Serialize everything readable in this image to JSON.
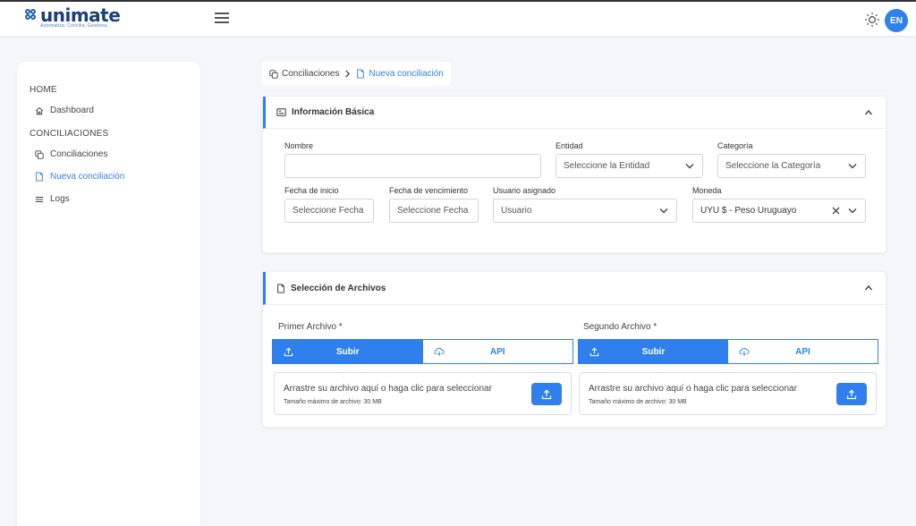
{
  "header": {
    "logo_name": "unimate",
    "logo_tagline": "Automatiza. Concilia. Gestiona.",
    "lang": "EN",
    "icons": {
      "menu": "hamburger-icon",
      "theme": "sun-icon"
    }
  },
  "sidebar": {
    "sections": [
      {
        "title": "HOME",
        "items": [
          {
            "label": "Dashboard",
            "icon": "home-icon"
          }
        ]
      },
      {
        "title": "CONCILIACIONES",
        "items": [
          {
            "label": "Conciliaciones",
            "icon": "copy-icon"
          },
          {
            "label": "Nueva conciliación",
            "icon": "file-icon",
            "active": true
          },
          {
            "label": "Logs",
            "icon": "list-icon"
          }
        ]
      }
    ]
  },
  "breadcrumb": {
    "parent": "Conciliaciones",
    "current": "Nueva conciliación"
  },
  "basic_info": {
    "title": "Información Básica",
    "nombre": {
      "label": "Nombre",
      "value": ""
    },
    "entidad": {
      "label": "Entidad",
      "placeholder": "Seleccione la Entidad"
    },
    "categoria": {
      "label": "Categoría",
      "placeholder": "Seleccione la Categoría"
    },
    "fecha_inicio": {
      "label": "Fecha de inicio",
      "placeholder": "Seleccione Fecha"
    },
    "fecha_vencimiento": {
      "label": "Fecha de vencimiento",
      "placeholder": "Seleccione Fecha"
    },
    "usuario": {
      "label": "Usuario asignado",
      "placeholder": "Usuario"
    },
    "moneda": {
      "label": "Moneda",
      "value": "UYU $ - Peso Uruguayo"
    }
  },
  "files": {
    "title": "Selección de Archivos",
    "first": {
      "label": "Primer Archivo",
      "required": "*"
    },
    "second": {
      "label": "Segundo Archivo",
      "required": "*"
    },
    "upload_label": "Subir",
    "api_label": "API",
    "drop_text": "Arrastre su archivo aquí o haga clic para seleccionar",
    "max_size": "Tamaño máximo de archivo: 30 MB"
  },
  "colors": {
    "accent": "#2f80ed",
    "brand": "#1a3f7a"
  }
}
